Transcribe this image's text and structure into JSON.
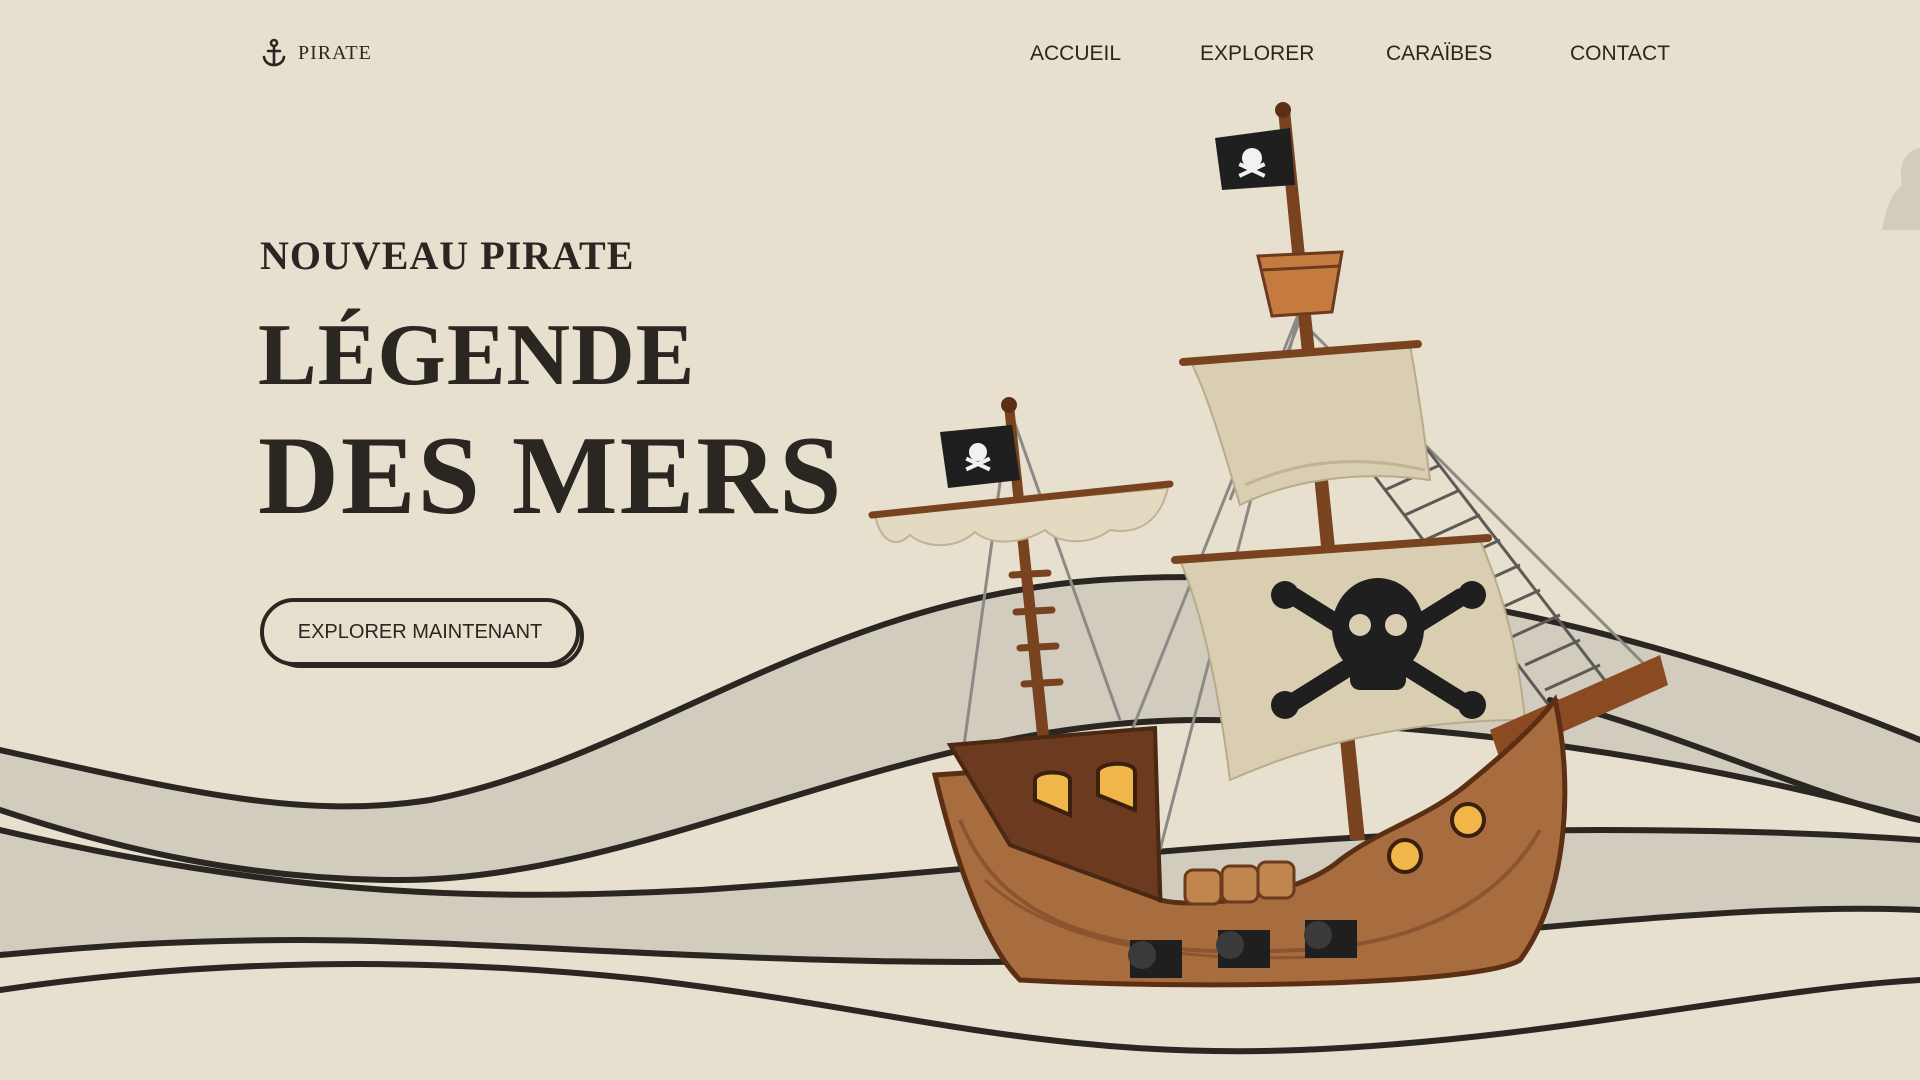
{
  "header": {
    "logo_text": "PIRATE",
    "logo_icon": "anchor-icon",
    "nav": [
      {
        "label": "ACCUEIL"
      },
      {
        "label": "EXPLORER"
      },
      {
        "label": "CARAÏBES"
      },
      {
        "label": "CONTACT"
      }
    ]
  },
  "hero": {
    "kicker": "NOUVEAU PIRATE",
    "title_line1": "LÉGENDE",
    "title_line2": "DES MERS",
    "cta_label": "EXPLORER MAINTENANT"
  },
  "illustration": {
    "subject": "pirate-ship",
    "flag_icon": "skull-crossbones-icon"
  },
  "colors": {
    "background": "#e7e0cf",
    "ink": "#2a2621",
    "wave_fill": "#d2ccbf",
    "hull": "#a86d3e",
    "hull_dark": "#6b3a1f",
    "sail": "#d9ceb2",
    "flag": "#1f1f1f"
  }
}
